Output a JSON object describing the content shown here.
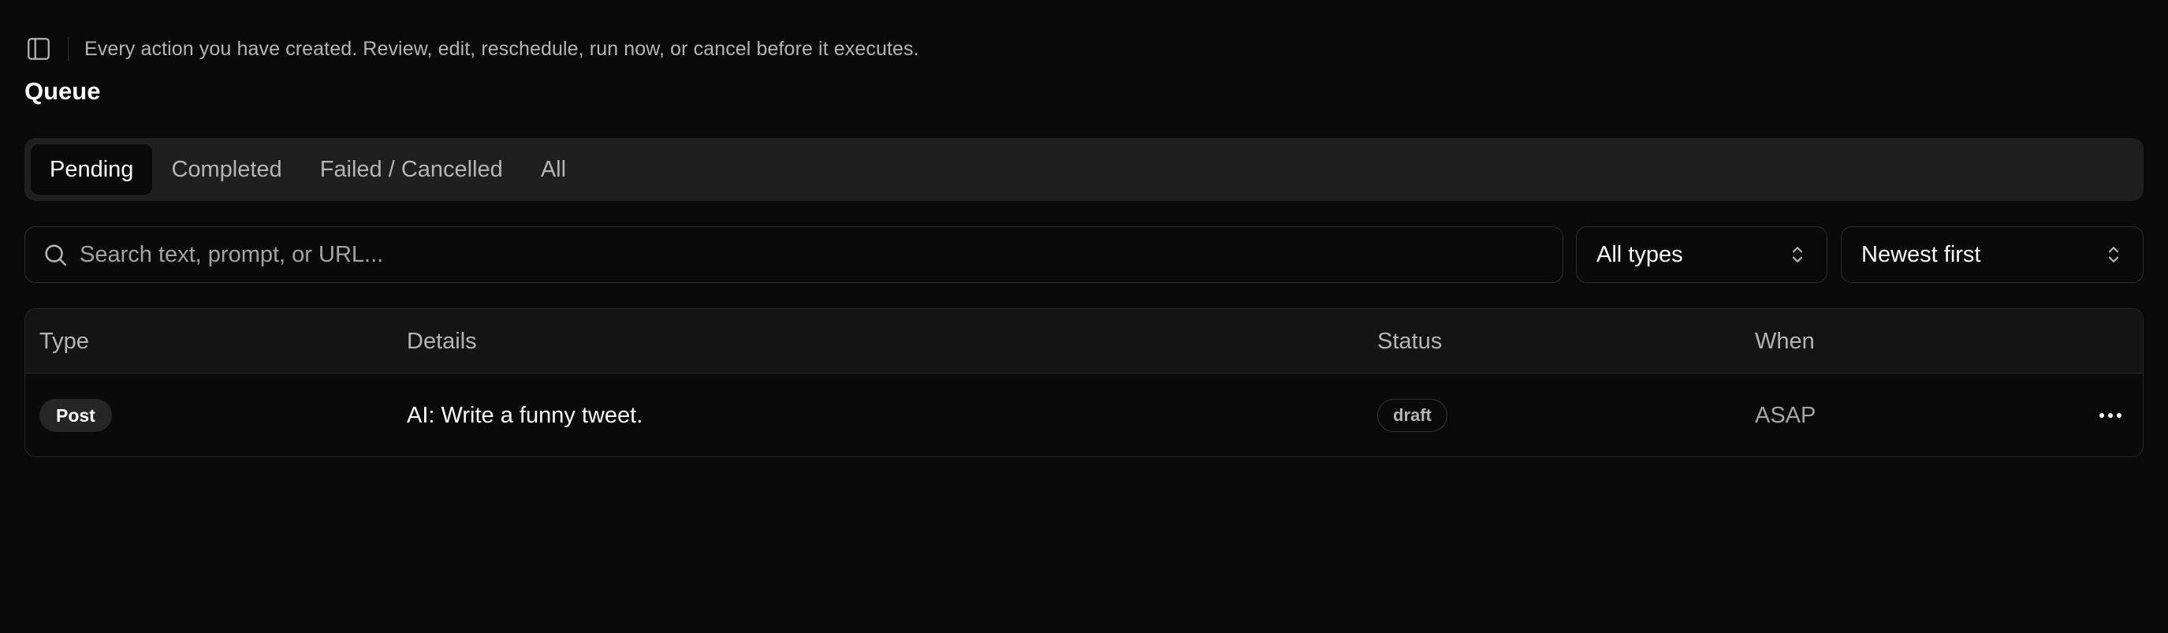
{
  "header": {
    "subtitle": "Every action you have created. Review, edit, reschedule, run now, or cancel before it executes.",
    "title": "Queue",
    "sidebar_toggle_icon": "panel-left-icon"
  },
  "tabs": [
    {
      "label": "Pending",
      "active": true
    },
    {
      "label": "Completed",
      "active": false
    },
    {
      "label": "Failed / Cancelled",
      "active": false
    },
    {
      "label": "All",
      "active": false
    }
  ],
  "search": {
    "placeholder": "Search text, prompt, or URL...",
    "value": "",
    "icon": "search-icon"
  },
  "filters": {
    "type_select": {
      "value": "All types",
      "icon": "chevrons-up-down-icon"
    },
    "sort_select": {
      "value": "Newest first",
      "icon": "chevrons-up-down-icon"
    }
  },
  "table": {
    "columns": [
      "Type",
      "Details",
      "Status",
      "When"
    ],
    "rows": [
      {
        "type": "Post",
        "details": "AI: Write a funny tweet.",
        "status": "draft",
        "when": "ASAP",
        "actions_icon": "more-horizontal-icon"
      }
    ]
  },
  "colors": {
    "background": "#0a0a0a",
    "tabs_background": "#1f1f1f",
    "border": "#2e2e2e",
    "text_primary": "#fafafa",
    "text_muted": "#b4b4b4"
  }
}
